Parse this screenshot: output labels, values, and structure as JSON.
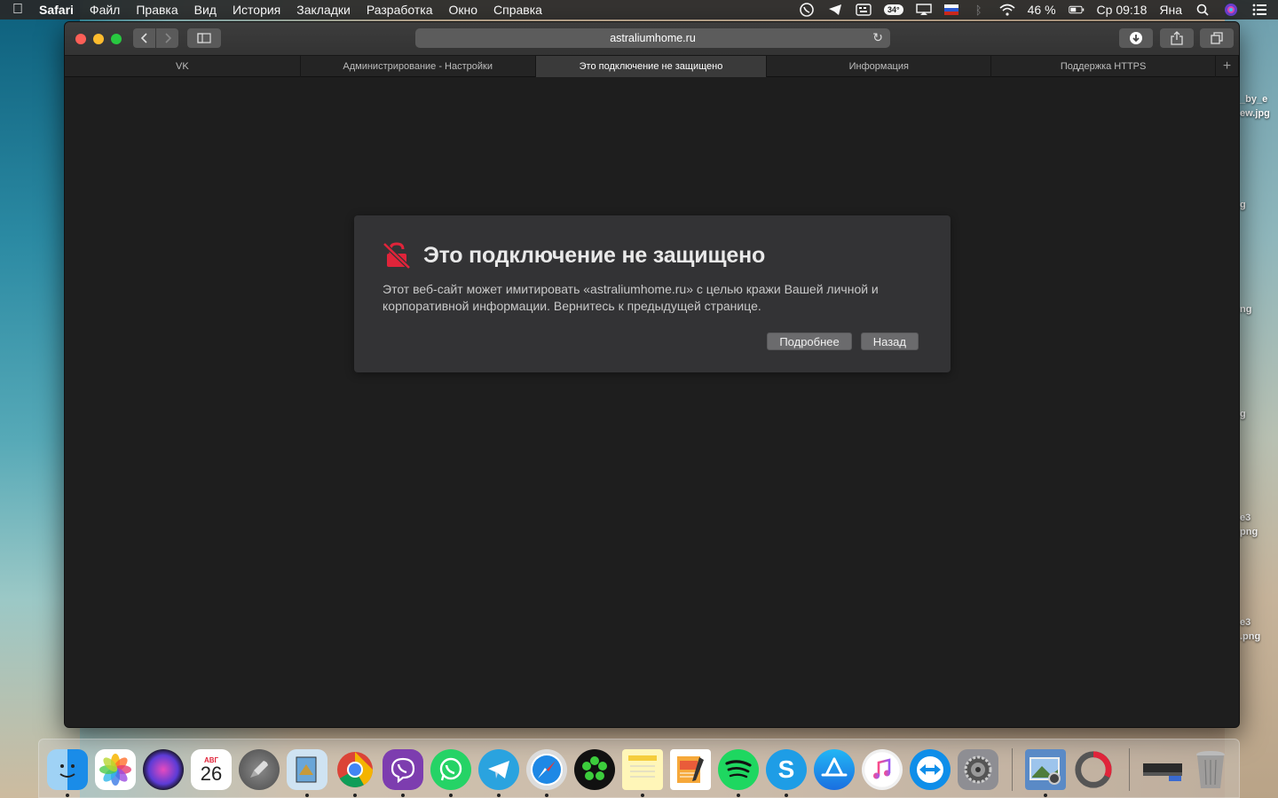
{
  "menubar": {
    "apple_icon": "apple-logo-icon",
    "app_name": "Safari",
    "items": [
      "Файл",
      "Правка",
      "Вид",
      "История",
      "Закладки",
      "Разработка",
      "Окно",
      "Справка"
    ],
    "status": {
      "temperature": "34°",
      "battery": "46 %",
      "datetime": "Ср 09:18",
      "user": "Яна"
    }
  },
  "safari": {
    "address": "astraliumhome.ru",
    "tabs": [
      {
        "label": "VK"
      },
      {
        "label": "Администрирование - Настройки"
      },
      {
        "label": "Это подключение не защищено"
      },
      {
        "label": "Информация"
      },
      {
        "label": "Поддержка HTTPS"
      }
    ],
    "active_tab_index": 2
  },
  "dialog": {
    "title": "Это подключение не защищено",
    "message": "Этот веб-сайт может имитировать «astraliumhome.ru» с целью кражи Вашей личной и корпоративной информации. Вернитесь к предыдущей странице.",
    "details_button": "Подробнее",
    "back_button": "Назад",
    "icon": "broken-lock-icon",
    "icon_color": "#e0243a"
  },
  "desktop_labels": [
    "_by_e",
    "ew.jpg",
    "g",
    "ng",
    "g",
    "e3",
    "png",
    "e3",
    ".png"
  ],
  "dock": {
    "calendar_month": "АВГ",
    "calendar_day": "26",
    "skype_letter": "S",
    "apps": [
      "finder",
      "photos",
      "siri",
      "calendar",
      "launchpad",
      "preview",
      "chrome",
      "viber",
      "whatsapp",
      "telegram",
      "safari",
      "icq",
      "notes",
      "pages",
      "spotify",
      "skype",
      "app-store",
      "itunes",
      "teamviewer",
      "system-preferences",
      "image-capture",
      "activity",
      "stacks",
      "trash"
    ]
  }
}
